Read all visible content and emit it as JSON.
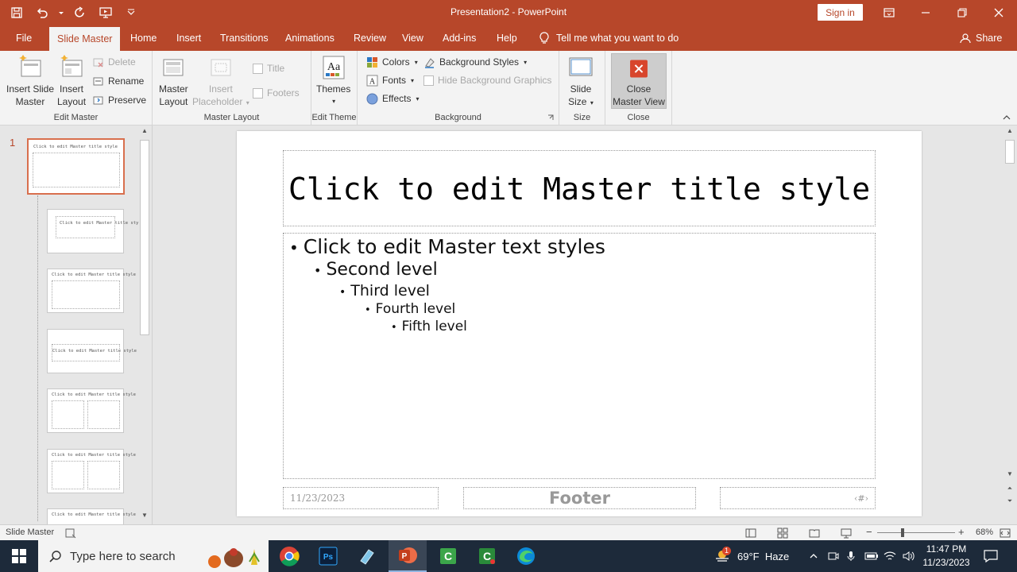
{
  "window": {
    "title": "Presentation2  -  PowerPoint",
    "sign_in": "Sign in"
  },
  "tabs": [
    {
      "label": "File"
    },
    {
      "label": "Slide Master"
    },
    {
      "label": "Home"
    },
    {
      "label": "Insert"
    },
    {
      "label": "Transitions"
    },
    {
      "label": "Animations"
    },
    {
      "label": "Review"
    },
    {
      "label": "View"
    },
    {
      "label": "Add-ins"
    },
    {
      "label": "Help"
    }
  ],
  "tell_me": "Tell me what you want to do",
  "share": "Share",
  "ribbon": {
    "edit_master": {
      "label": "Edit Master",
      "insert_slide_master": "Insert Slide Master",
      "insert_slide_master_l1": "Insert Slide",
      "insert_slide_master_l2": "Master",
      "insert_layout_l1": "Insert",
      "insert_layout_l2": "Layout",
      "delete": "Delete",
      "rename": "Rename",
      "preserve": "Preserve"
    },
    "master_layout": {
      "label": "Master Layout",
      "master_layout_l1": "Master",
      "master_layout_l2": "Layout",
      "insert_placeholder_l1": "Insert",
      "insert_placeholder_l2": "Placeholder",
      "title": "Title",
      "footers": "Footers"
    },
    "edit_theme": {
      "label": "Edit Theme",
      "themes": "Themes"
    },
    "background": {
      "label": "Background",
      "colors": "Colors",
      "fonts": "Fonts",
      "effects": "Effects",
      "background_styles": "Background Styles",
      "hide_background_graphics": "Hide Background Graphics"
    },
    "size": {
      "label": "Size",
      "slide_size_l1": "Slide",
      "slide_size_l2": "Size"
    },
    "close": {
      "label": "Close",
      "close_master_view_l1": "Close",
      "close_master_view_l2": "Master View"
    }
  },
  "thumbnails": {
    "selected_number": "1",
    "items": [
      {
        "text": "Click to edit Master title style"
      },
      {
        "text": "Click to edit Master title style"
      },
      {
        "text": "Click to edit Master title style"
      },
      {
        "text": "Click to edit Master title style"
      },
      {
        "text": "Click to edit Master title style"
      },
      {
        "text": "Click to edit Master title style"
      },
      {
        "text": "Click to edit Master title style"
      }
    ]
  },
  "slide": {
    "title": "Click to edit Master title style",
    "levels": [
      "Click to edit Master text styles",
      "Second level",
      "Third level",
      "Fourth level",
      "Fifth level"
    ],
    "date": "11/23/2023",
    "footer": "Footer",
    "slide_number": "‹#›"
  },
  "status": {
    "view_name": "Slide Master",
    "zoom": "68%"
  },
  "taskbar": {
    "search_placeholder": "Type here to search",
    "weather": "69°F  Haze",
    "weather_badge": "1",
    "time": "11:47 PM",
    "date": "11/23/2023"
  },
  "colors": {
    "accent": "#b7472a",
    "taskbar": "#1d2a3a"
  }
}
